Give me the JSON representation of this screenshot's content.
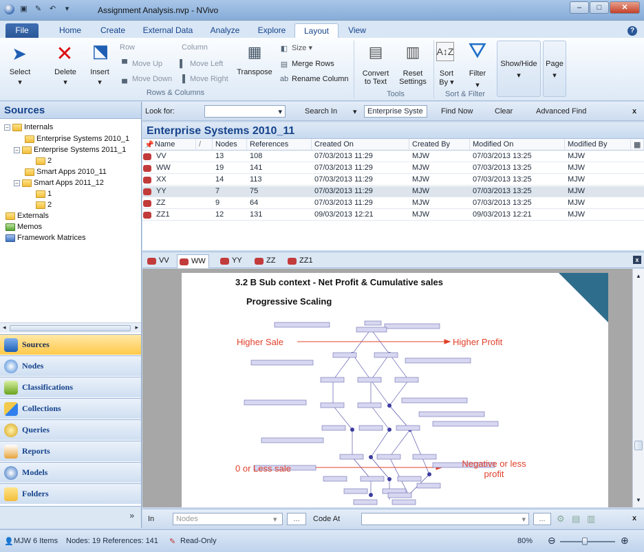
{
  "window": {
    "title": "Assignment Analysis.nvp - NVivo"
  },
  "ribbon_tabs": [
    "File",
    "Home",
    "Create",
    "External Data",
    "Analyze",
    "Explore",
    "Layout",
    "View"
  ],
  "ribbon": {
    "select": "Select",
    "delete": "Delete",
    "insert": "Insert",
    "row": "Row",
    "column": "Column",
    "move_up": "Move Up",
    "move_down": "Move Down",
    "move_left": "Move Left",
    "move_right": "Move Right",
    "rows_columns_group": "Rows & Columns",
    "transpose": "Transpose",
    "size": "Size",
    "merge_rows": "Merge Rows",
    "rename_column": "Rename Column",
    "convert_to_text_1": "Convert",
    "convert_to_text_2": "to Text",
    "reset_settings_1": "Reset",
    "reset_settings_2": "Settings",
    "tools_group": "Tools",
    "sort_by_1": "Sort",
    "sort_by_2": "By",
    "filter": "Filter",
    "sort_filter_group": "Sort & Filter",
    "show_hide": "Show/Hide",
    "page": "Page"
  },
  "sources_panel": {
    "header": "Sources",
    "tree": [
      {
        "label": "Internals"
      },
      {
        "label": "Enterprise Systems 2010_1"
      },
      {
        "label": "Enterprise Systems 2011_1"
      },
      {
        "label": "2"
      },
      {
        "label": "Smart Apps 2010_11"
      },
      {
        "label": "Smart Apps 2011_12"
      },
      {
        "label": "1"
      },
      {
        "label": "2"
      },
      {
        "label": "Externals"
      },
      {
        "label": "Memos"
      },
      {
        "label": "Framework Matrices"
      }
    ],
    "nav": [
      "Sources",
      "Nodes",
      "Classifications",
      "Collections",
      "Queries",
      "Reports",
      "Models",
      "Folders"
    ]
  },
  "findbar": {
    "look_for": "Look for:",
    "search_in": "Search In",
    "scope": "Enterprise Syste",
    "find_now": "Find Now",
    "clear": "Clear",
    "advanced_find": "Advanced Find",
    "close": "x"
  },
  "list": {
    "title": "Enterprise Systems 2010_11",
    "columns": [
      "Name",
      "Nodes",
      "References",
      "Created On",
      "Created By",
      "Modified On",
      "Modified By"
    ],
    "rows": [
      [
        "VV",
        "13",
        "108",
        "07/03/2013 11:29",
        "MJW",
        "07/03/2013 13:25",
        "MJW"
      ],
      [
        "WW",
        "19",
        "141",
        "07/03/2013 11:29",
        "MJW",
        "07/03/2013 13:25",
        "MJW"
      ],
      [
        "XX",
        "14",
        "113",
        "07/03/2013 11:29",
        "MJW",
        "07/03/2013 13:25",
        "MJW"
      ],
      [
        "YY",
        "7",
        "75",
        "07/03/2013 11:29",
        "MJW",
        "07/03/2013 13:25",
        "MJW"
      ],
      [
        "ZZ",
        "9",
        "64",
        "07/03/2013 11:29",
        "MJW",
        "07/03/2013 13:25",
        "MJW"
      ],
      [
        "ZZ1",
        "12",
        "131",
        "09/03/2013 12:21",
        "MJW",
        "09/03/2013 12:21",
        "MJW"
      ]
    ]
  },
  "doc_tabs": [
    "VV",
    "WW",
    "YY",
    "ZZ",
    "ZZ1"
  ],
  "document": {
    "heading": "3.2 B Sub context - Net Profit & Cumulative sales",
    "subheading": "Progressive Scaling",
    "higher_sale": "Higher Sale",
    "higher_profit": "Higher Profit",
    "less_sale": "0 or Less sale",
    "less_profit_1": "Negative or less",
    "less_profit_2": "profit",
    "accent_color": "#2f6d8c"
  },
  "codebar": {
    "in": "In",
    "nodes_placeholder": "Nodes",
    "code_at": "Code At",
    "close": "x"
  },
  "status": {
    "user": "MJW",
    "items": "6 Items",
    "counts": "Nodes: 19  References: 141",
    "readonly": "Read-Only",
    "zoom": "80%"
  }
}
